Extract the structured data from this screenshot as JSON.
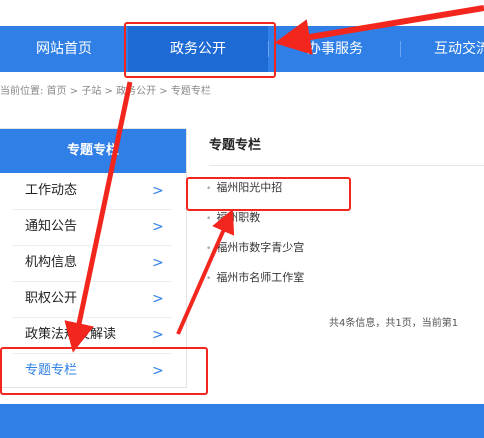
{
  "nav": {
    "items": [
      "网站首页",
      "政务公开",
      "办事服务",
      "互动交流"
    ]
  },
  "breadcrumb": {
    "prefix": "当前位置:",
    "home": "首页",
    "sep": ">",
    "sub": "子站",
    "gov": "政务公开",
    "current": "专题专栏"
  },
  "sidebar": {
    "title": "专题专栏",
    "arrow": ">",
    "items": [
      "工作动态",
      "通知公告",
      "机构信息",
      "职权公开",
      "政策法规及解读",
      "专题专栏"
    ],
    "active_index": 5
  },
  "content": {
    "title": "专题专栏",
    "bullet": "•",
    "articles": [
      "福州阳光中招",
      "福州职教",
      "福州市数字青少宫",
      "福州市名师工作室"
    ],
    "pager_text": "共4条信息，共1页，当前第1"
  },
  "colors": {
    "primary": "#2f7fe6",
    "active_nav": "#1e6ad4",
    "annotation": "#f3261e"
  }
}
